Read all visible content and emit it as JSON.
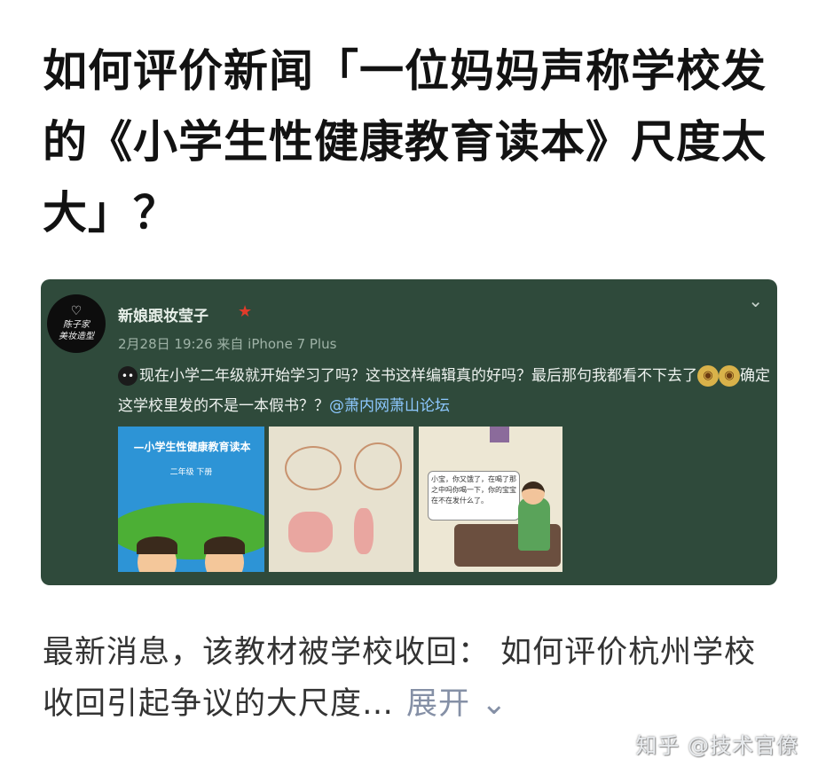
{
  "question": {
    "title": "如何评价新闻「一位妈妈声称学校发的《小学生性健康教育读本》尺度太大」？"
  },
  "weibo_card": {
    "avatar_text_line1": "陈子家",
    "avatar_text_line2": "美妆造型",
    "username": "新娘跟妆莹子",
    "meta": "2月28日 19:26 来自 iPhone 7 Plus",
    "post_text_a": "现在小学二年级就开始学习了吗？这书这样编辑真的好吗？最后那句我都看不下去了",
    "post_text_b": "确定这学校里发的不是一本假书？？",
    "mention": "@萧内网萧山论坛",
    "book_title": "—小学生性健康教育读本",
    "book_grade": "二年级  下册",
    "bubble_text": "小宝，你又饿了，在喝了那之中吗你喝一下，你的宝宝在不在发什么了。"
  },
  "answer_excerpt": {
    "text": "最新消息，该教材被学校收回： 如何评价杭州学校收回引起争议的大尺度…",
    "expand_label": "展开"
  },
  "watermark": "知乎 @技术官僚"
}
